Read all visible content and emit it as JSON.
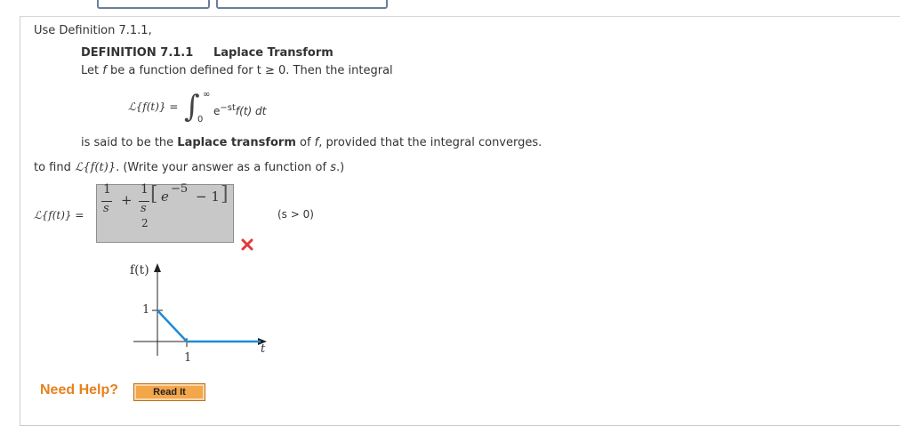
{
  "intro": "Use Definition 7.1.1,",
  "definition": {
    "number": "DEFINITION 7.1.1",
    "title": "Laplace Transform",
    "line1_pre": "Let ",
    "line1_f": "f",
    "line1_post": " be a function defined for t ≥ 0. Then the integral",
    "formula_lhs": "ℒ{f(t)} =",
    "formula_upper": "∞",
    "formula_lower": "0",
    "formula_integrand_e": "e",
    "formula_exponent": "−st",
    "formula_tail": "f(t) dt",
    "line2_pre": "is said to be the ",
    "line2_bold": "Laplace transform",
    "line2_mid": " of ",
    "line2_f": "f",
    "line2_post": ", provided that the integral converges."
  },
  "task": {
    "pre": "to find ",
    "expr": "ℒ{f(t)}",
    "post": ". (Write your answer as a function of ",
    "var": "s",
    "end": ".)"
  },
  "answer": {
    "lhs": "ℒ{f(t)} =",
    "frac1_num": "1",
    "frac1_den": "s",
    "plus": "+",
    "frac2_num": "1",
    "frac2_den_top": "s",
    "frac2_den_bot": "2",
    "bracket_open": "[",
    "base": "e",
    "exponent": "−5",
    "minus_one": "− 1",
    "bracket_close": "]",
    "condition": "(s > 0)",
    "status": "incorrect",
    "status_color": "#e03a3a"
  },
  "graph": {
    "ylabel": "f(t)",
    "ytick": "1",
    "xtick": "1",
    "xlabel": "t",
    "line_color": "#1e8ad6"
  },
  "help": {
    "label": "Need Help?",
    "button": "Read It"
  }
}
